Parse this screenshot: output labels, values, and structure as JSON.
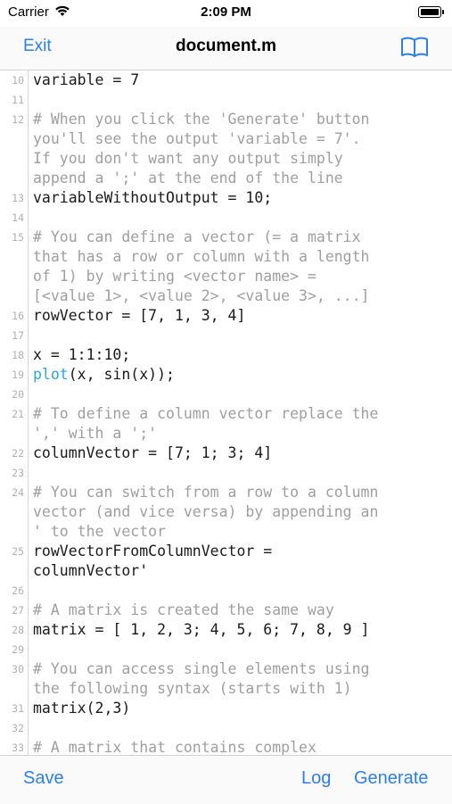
{
  "status": {
    "carrier": "Carrier",
    "time": "2:09 PM"
  },
  "nav": {
    "exit": "Exit",
    "title": "document.m",
    "book_icon": "book-icon"
  },
  "toolbar": {
    "save": "Save",
    "log": "Log",
    "generate": "Generate"
  },
  "lines": [
    {
      "n": "10",
      "text": "variable = 7",
      "kind": "code"
    },
    {
      "n": "11",
      "text": "",
      "kind": "code"
    },
    {
      "n": "12",
      "text": "# When you click the 'Generate' button",
      "kind": "comment"
    },
    {
      "n": "",
      "text": "you'll see the output 'variable = 7'.",
      "kind": "comment"
    },
    {
      "n": "",
      "text": "If you don't want any output simply",
      "kind": "comment"
    },
    {
      "n": "",
      "text": "append a ';' at the end of the line",
      "kind": "comment"
    },
    {
      "n": "13",
      "text": "variableWithoutOutput = 10;",
      "kind": "code"
    },
    {
      "n": "14",
      "text": "",
      "kind": "code"
    },
    {
      "n": "15",
      "text": "# You can define a vector (= a matrix",
      "kind": "comment"
    },
    {
      "n": "",
      "text": "that has a row or column with a length",
      "kind": "comment"
    },
    {
      "n": "",
      "text": "of 1) by writing <vector name> =",
      "kind": "comment"
    },
    {
      "n": "",
      "text": "[<value 1>, <value 2>, <value 3>, ...]",
      "kind": "comment"
    },
    {
      "n": "16",
      "text": "rowVector = [7, 1, 3, 4]",
      "kind": "code"
    },
    {
      "n": "17",
      "text": "",
      "kind": "code"
    },
    {
      "n": "18",
      "text": "x = 1:1:10;",
      "kind": "code"
    },
    {
      "n": "19",
      "text": "plot(x, sin(x));",
      "kind": "code",
      "fn": "plot"
    },
    {
      "n": "20",
      "text": "",
      "kind": "code"
    },
    {
      "n": "21",
      "text": "# To define a column vector replace the",
      "kind": "comment"
    },
    {
      "n": "",
      "text": "',' with a ';'",
      "kind": "comment"
    },
    {
      "n": "22",
      "text": "columnVector = [7; 1; 3; 4]",
      "kind": "code"
    },
    {
      "n": "23",
      "text": "",
      "kind": "code"
    },
    {
      "n": "24",
      "text": "# You can switch from a row to a column",
      "kind": "comment"
    },
    {
      "n": "",
      "text": "vector (and vice versa) by appending an",
      "kind": "comment"
    },
    {
      "n": "",
      "text": "' to the vector",
      "kind": "comment"
    },
    {
      "n": "25",
      "text": "rowVectorFromColumnVector =",
      "kind": "code"
    },
    {
      "n": "",
      "text": "columnVector'",
      "kind": "code"
    },
    {
      "n": "26",
      "text": "",
      "kind": "code"
    },
    {
      "n": "27",
      "text": "# A matrix is created the same way",
      "kind": "comment"
    },
    {
      "n": "28",
      "text": "matrix = [ 1, 2, 3; 4, 5, 6; 7, 8, 9 ]",
      "kind": "code"
    },
    {
      "n": "29",
      "text": "",
      "kind": "code"
    },
    {
      "n": "30",
      "text": "# You can access single elements using",
      "kind": "comment"
    },
    {
      "n": "",
      "text": "the following syntax (starts with 1)",
      "kind": "comment"
    },
    {
      "n": "31",
      "text": "matrix(2,3)",
      "kind": "code"
    },
    {
      "n": "32",
      "text": "",
      "kind": "code"
    },
    {
      "n": "33",
      "text": "# A matrix that contains complex",
      "kind": "comment"
    }
  ]
}
